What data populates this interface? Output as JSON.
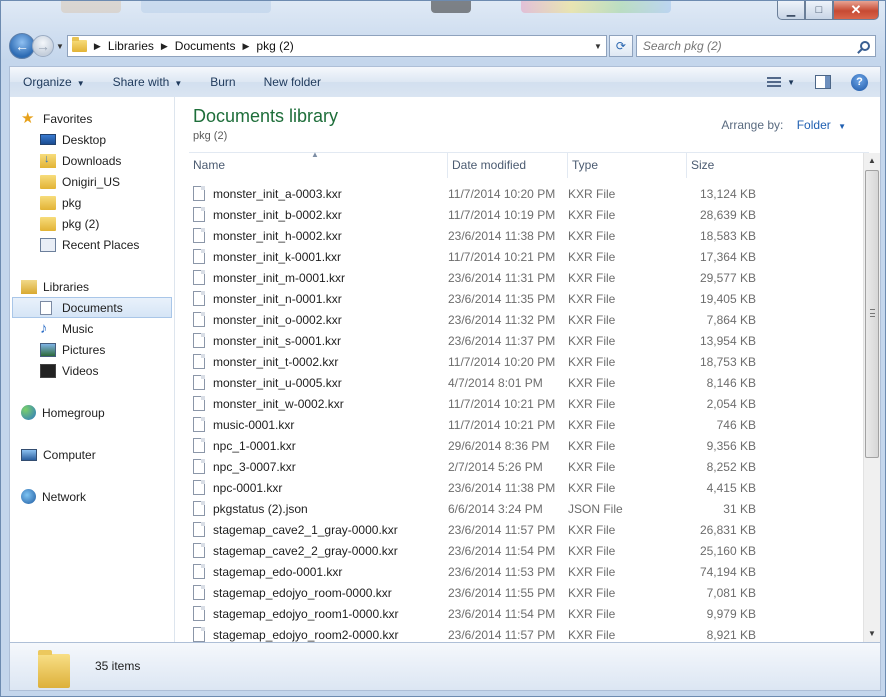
{
  "window": {
    "minimize_glyph": "▁",
    "maximize_glyph": "□",
    "close_glyph": "✕"
  },
  "nav": {
    "back_glyph": "←",
    "forward_glyph": "→",
    "breadcrumb": [
      "Libraries",
      "Documents",
      "pkg (2)"
    ],
    "search_placeholder": "Search pkg (2)"
  },
  "toolbar": {
    "organize_label": "Organize",
    "share_label": "Share with",
    "burn_label": "Burn",
    "new_folder_label": "New folder",
    "help_label": "?"
  },
  "sidebar": {
    "favorites_label": "Favorites",
    "favorites": [
      "Desktop",
      "Downloads",
      "Onigiri_US",
      "pkg",
      "pkg (2)",
      "Recent Places"
    ],
    "libraries_label": "Libraries",
    "libraries": [
      "Documents",
      "Music",
      "Pictures",
      "Videos"
    ],
    "homegroup_label": "Homegroup",
    "computer_label": "Computer",
    "network_label": "Network"
  },
  "main": {
    "title": "Documents library",
    "subtitle": "pkg (2)",
    "arrange_label": "Arrange by:",
    "arrange_value": "Folder",
    "columns": [
      "Name",
      "Date modified",
      "Type",
      "Size"
    ],
    "files": [
      {
        "name": "monster_init_a-0003.kxr",
        "date": "11/7/2014 10:20 PM",
        "type": "KXR File",
        "size": "13,124 KB"
      },
      {
        "name": "monster_init_b-0002.kxr",
        "date": "11/7/2014 10:19 PM",
        "type": "KXR File",
        "size": "28,639 KB"
      },
      {
        "name": "monster_init_h-0002.kxr",
        "date": "23/6/2014 11:38 PM",
        "type": "KXR File",
        "size": "18,583 KB"
      },
      {
        "name": "monster_init_k-0001.kxr",
        "date": "11/7/2014 10:21 PM",
        "type": "KXR File",
        "size": "17,364 KB"
      },
      {
        "name": "monster_init_m-0001.kxr",
        "date": "23/6/2014 11:31 PM",
        "type": "KXR File",
        "size": "29,577 KB"
      },
      {
        "name": "monster_init_n-0001.kxr",
        "date": "23/6/2014 11:35 PM",
        "type": "KXR File",
        "size": "19,405 KB"
      },
      {
        "name": "monster_init_o-0002.kxr",
        "date": "23/6/2014 11:32 PM",
        "type": "KXR File",
        "size": "7,864 KB"
      },
      {
        "name": "monster_init_s-0001.kxr",
        "date": "23/6/2014 11:37 PM",
        "type": "KXR File",
        "size": "13,954 KB"
      },
      {
        "name": "monster_init_t-0002.kxr",
        "date": "11/7/2014 10:20 PM",
        "type": "KXR File",
        "size": "18,753 KB"
      },
      {
        "name": "monster_init_u-0005.kxr",
        "date": "4/7/2014 8:01 PM",
        "type": "KXR File",
        "size": "8,146 KB"
      },
      {
        "name": "monster_init_w-0002.kxr",
        "date": "11/7/2014 10:21 PM",
        "type": "KXR File",
        "size": "2,054 KB"
      },
      {
        "name": "music-0001.kxr",
        "date": "11/7/2014 10:21 PM",
        "type": "KXR File",
        "size": "746 KB"
      },
      {
        "name": "npc_1-0001.kxr",
        "date": "29/6/2014 8:36 PM",
        "type": "KXR File",
        "size": "9,356 KB"
      },
      {
        "name": "npc_3-0007.kxr",
        "date": "2/7/2014 5:26 PM",
        "type": "KXR File",
        "size": "8,252 KB"
      },
      {
        "name": "npc-0001.kxr",
        "date": "23/6/2014 11:38 PM",
        "type": "KXR File",
        "size": "4,415 KB"
      },
      {
        "name": "pkgstatus (2).json",
        "date": "6/6/2014 3:24 PM",
        "type": "JSON File",
        "size": "31 KB"
      },
      {
        "name": "stagemap_cave2_1_gray-0000.kxr",
        "date": "23/6/2014 11:57 PM",
        "type": "KXR File",
        "size": "26,831 KB"
      },
      {
        "name": "stagemap_cave2_2_gray-0000.kxr",
        "date": "23/6/2014 11:54 PM",
        "type": "KXR File",
        "size": "25,160 KB"
      },
      {
        "name": "stagemap_edo-0001.kxr",
        "date": "23/6/2014 11:53 PM",
        "type": "KXR File",
        "size": "74,194 KB"
      },
      {
        "name": "stagemap_edojyo_room-0000.kxr",
        "date": "23/6/2014 11:55 PM",
        "type": "KXR File",
        "size": "7,081 KB"
      },
      {
        "name": "stagemap_edojyo_room1-0000.kxr",
        "date": "23/6/2014 11:54 PM",
        "type": "KXR File",
        "size": "9,979 KB"
      },
      {
        "name": "stagemap_edojyo_room2-0000.kxr",
        "date": "23/6/2014 11:57 PM",
        "type": "KXR File",
        "size": "8,921 KB"
      }
    ]
  },
  "status": {
    "item_count": "35 items"
  }
}
